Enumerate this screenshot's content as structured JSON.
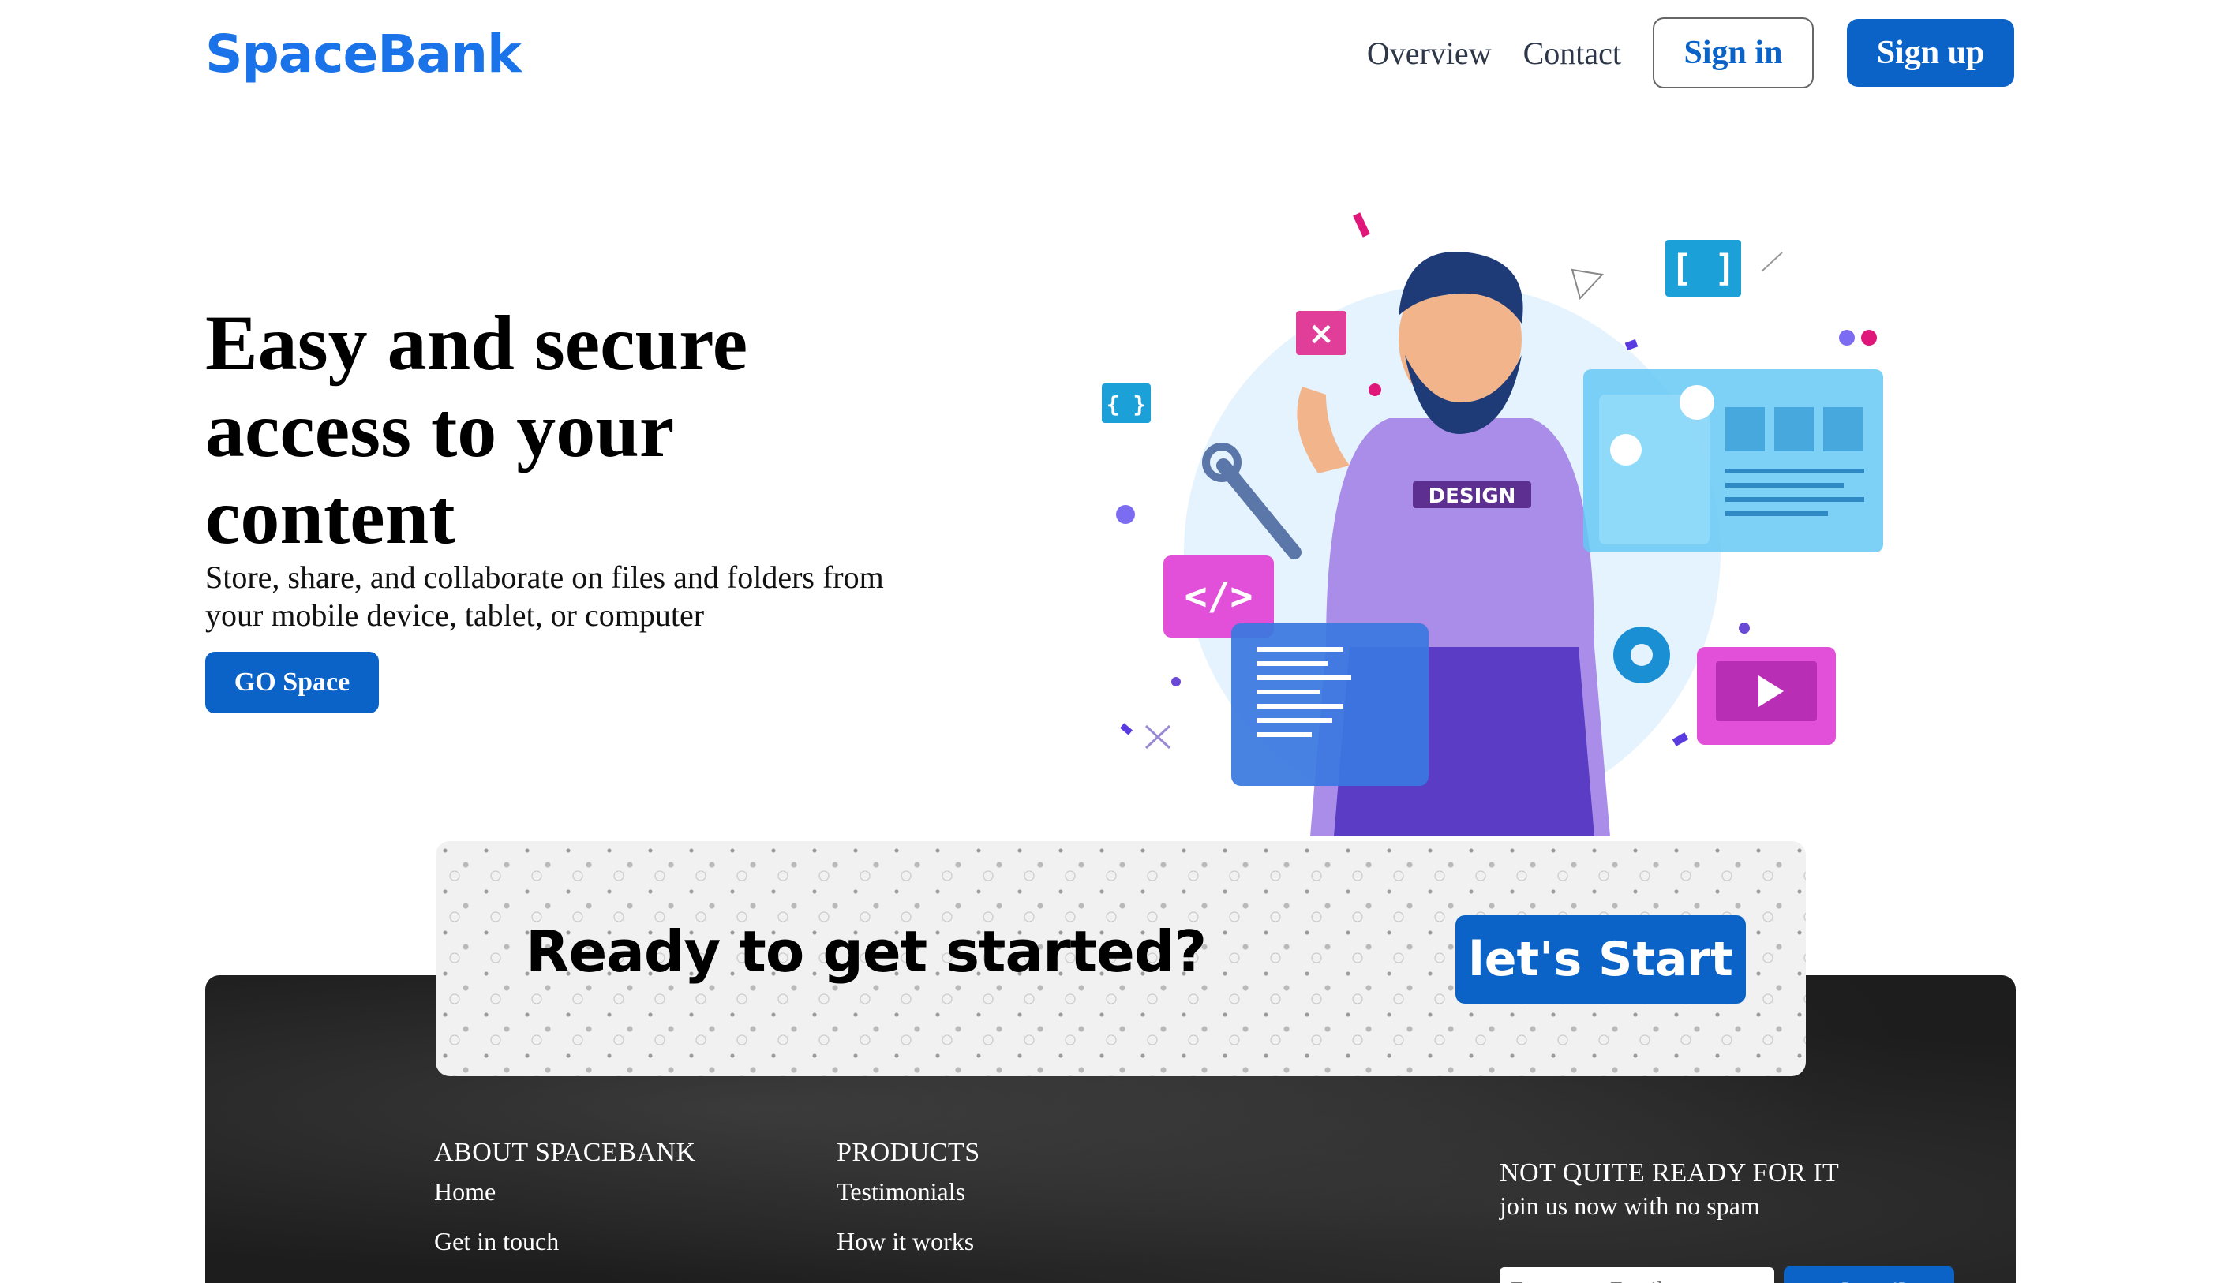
{
  "header": {
    "logo": "SpaceBank",
    "nav": {
      "overview": "Overview",
      "contact": "Contact"
    },
    "sign_in": "Sign in",
    "sign_up": "Sign up"
  },
  "hero": {
    "title": "Easy and secure access to your content",
    "subtitle": "Store, share, and collaborate on files and folders from your mobile device, tablet, or computer",
    "cta_label": "GO Space",
    "illustration_text": "DESIGN"
  },
  "cta_card": {
    "title": "Ready to get started?",
    "button": "let's Start"
  },
  "footer": {
    "about": {
      "heading": "ABOUT SPACEBANK",
      "links": [
        "Home",
        "Get in touch"
      ]
    },
    "products": {
      "heading": "PRODUCTS",
      "links": [
        "Testimonials",
        "How it works"
      ]
    },
    "newsletter": {
      "heading": "NOT QUITE READY FOR IT",
      "text": "join us now with no spam",
      "placeholder": "Enter your Email",
      "button": "Subscribe"
    }
  },
  "colors": {
    "brand": "#1a73e8",
    "button": "#0b63c7",
    "footer_bg": "#1d1d1d"
  }
}
